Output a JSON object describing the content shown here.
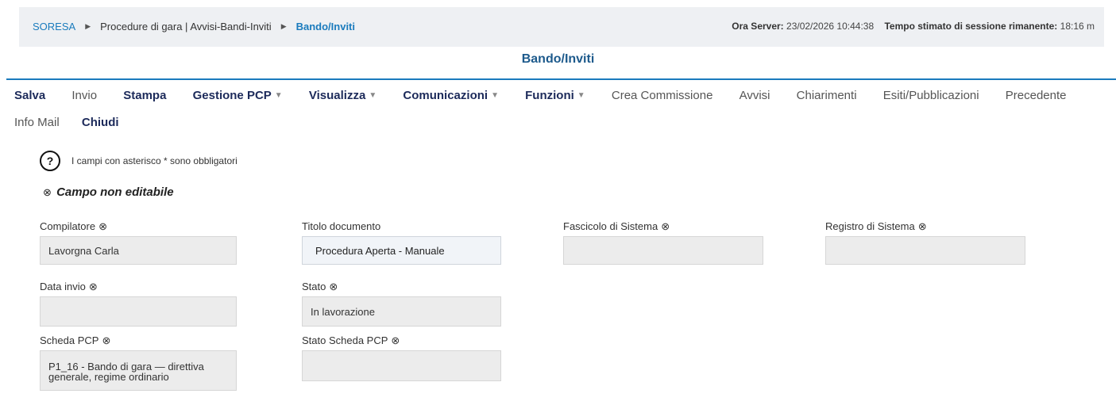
{
  "breadcrumb": {
    "home": "SORESA",
    "section": "Procedure di gara | Avvisi-Bandi-Inviti",
    "current": "Bando/Inviti"
  },
  "server": {
    "time_label": "Ora Server:",
    "time_value": "23/02/2026 10:44:38",
    "session_label": "Tempo stimato di sessione rimanente:",
    "session_value": "18:16 m"
  },
  "page": {
    "title": "Bando/Inviti"
  },
  "menu": {
    "salva": "Salva",
    "invio": "Invio",
    "stampa": "Stampa",
    "gestione_pcp": "Gestione PCP",
    "visualizza": "Visualizza",
    "comunicazioni": "Comunicazioni",
    "funzioni": "Funzioni",
    "crea_commissione": "Crea Commissione",
    "avvisi": "Avvisi",
    "chiarimenti": "Chiarimenti",
    "esiti": "Esiti/Pubblicazioni",
    "precedente": "Precedente",
    "info_mail": "Info Mail",
    "chiudi": "Chiudi"
  },
  "help": {
    "icon": "question-circle-icon",
    "text": "I campi con asterisco * sono obbligatori"
  },
  "legend": {
    "icon": "circle-x-icon",
    "text": "Campo non editabile"
  },
  "form": {
    "compilatore": {
      "label": "Compilatore",
      "value": "Lavorgna Carla"
    },
    "titolo": {
      "label": "Titolo documento",
      "value": "Procedura Aperta - Manuale"
    },
    "fascicolo": {
      "label": "Fascicolo di Sistema",
      "value": ""
    },
    "registro": {
      "label": "Registro di Sistema",
      "value": ""
    },
    "data_invio": {
      "label": "Data invio",
      "value": ""
    },
    "stato": {
      "label": "Stato",
      "value": "In lavorazione"
    },
    "scheda_pcp": {
      "label": "Scheda PCP",
      "value": "P1_16 - Bando di gara — direttiva generale, regime ordinario"
    },
    "stato_scheda": {
      "label": "Stato Scheda PCP",
      "value": ""
    }
  },
  "colors": {
    "accent": "#1a7bbd",
    "title": "#1d5a8c",
    "menu_bold": "#1c2a5a"
  }
}
